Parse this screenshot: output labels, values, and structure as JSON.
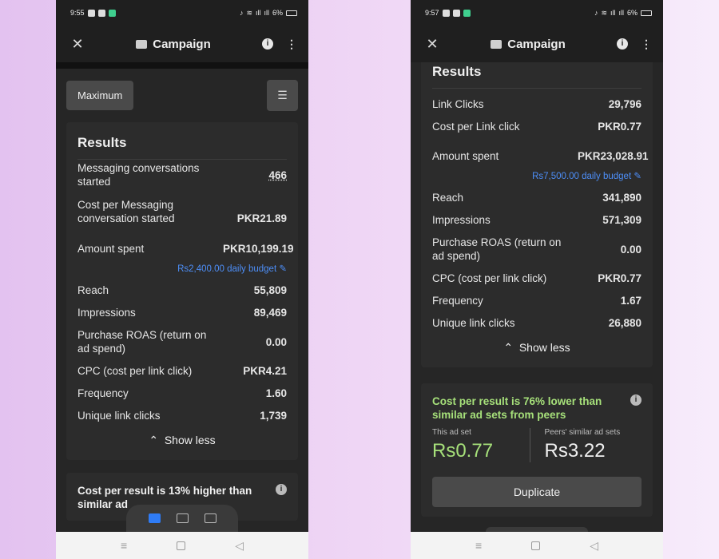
{
  "left": {
    "status": {
      "time": "9:55",
      "battery": "6%"
    },
    "header": {
      "title": "Campaign",
      "close_icon": "close-icon",
      "info_icon": "info-icon",
      "menu_icon": "more-vertical-icon"
    },
    "maximum_label": "Maximum",
    "results": {
      "title": "Results",
      "rows": [
        {
          "label": "Messaging conversations started",
          "value": "466"
        },
        {
          "label": "Cost per Messaging conversation started",
          "value": "PKR21.89"
        },
        {
          "label": "Amount spent",
          "value": "PKR10,199.19"
        }
      ],
      "budget": "Rs2,400.00 daily budget",
      "rows2": [
        {
          "label": "Reach",
          "value": "55,809"
        },
        {
          "label": "Impressions",
          "value": "89,469"
        },
        {
          "label": "Purchase ROAS (return on ad spend)",
          "value": "0.00"
        },
        {
          "label": "CPC (cost per link click)",
          "value": "PKR4.21"
        },
        {
          "label": "Frequency",
          "value": "1.60"
        },
        {
          "label": "Unique link clicks",
          "value": "1,739"
        }
      ],
      "show_less": "Show less"
    },
    "peer_partial": "Cost per result is 13% higher than similar ad"
  },
  "right": {
    "status": {
      "time": "9:57",
      "battery": "6%"
    },
    "header": {
      "title": "Campaign"
    },
    "results": {
      "title": "Results",
      "rows": [
        {
          "label": "Link Clicks",
          "value": "29,796"
        },
        {
          "label": "Cost per Link click",
          "value": "PKR0.77"
        },
        {
          "label": "Amount spent",
          "value": "PKR23,028.91"
        }
      ],
      "budget": "Rs7,500.00 daily budget",
      "rows2": [
        {
          "label": "Reach",
          "value": "341,890"
        },
        {
          "label": "Impressions",
          "value": "571,309"
        },
        {
          "label": "Purchase ROAS (return on ad spend)",
          "value": "0.00"
        },
        {
          "label": "CPC (cost per link click)",
          "value": "PKR0.77"
        },
        {
          "label": "Frequency",
          "value": "1.67"
        },
        {
          "label": "Unique link clicks",
          "value": "26,880"
        }
      ],
      "show_less": "Show less"
    },
    "peer": {
      "headline": "Cost per result is 76% lower than similar ad sets from peers",
      "this_caption": "This ad set",
      "this_value": "Rs0.77",
      "peer_caption": "Peers' similar ad sets",
      "peer_value": "Rs3.22"
    },
    "duplicate_label": "Duplicate"
  }
}
